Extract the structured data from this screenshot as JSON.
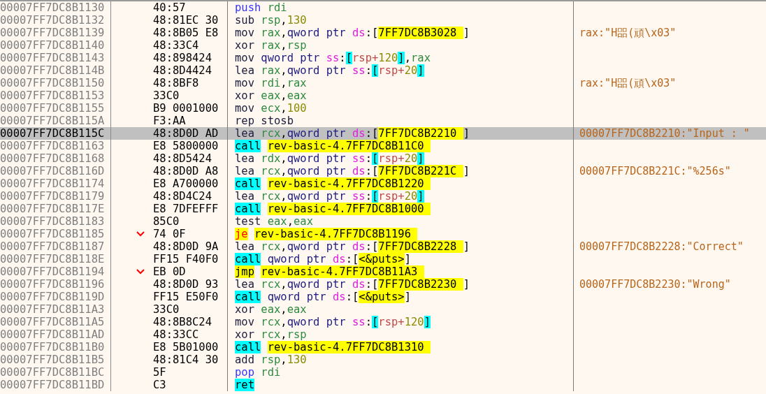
{
  "rows": [
    {
      "address": "00007FF7DC8B1130",
      "bytes": "40:57",
      "branch": false,
      "selected": false,
      "instruction": [
        {
          "text": "push ",
          "kind": "stack"
        },
        {
          "text": "rdi",
          "kind": "register"
        }
      ]
    },
    {
      "address": "00007FF7DC8B1132",
      "bytes": "48:81EC 30",
      "branch": false,
      "selected": false,
      "instruction": [
        {
          "text": "sub ",
          "kind": "mnemonic"
        },
        {
          "text": "rsp",
          "kind": "register"
        },
        {
          "text": ",",
          "kind": "punct"
        },
        {
          "text": "130",
          "kind": "number"
        }
      ]
    },
    {
      "address": "00007FF7DC8B1139",
      "bytes": "48:8B05 E8",
      "branch": false,
      "selected": false,
      "instruction": [
        {
          "text": "mov ",
          "kind": "mnemonic"
        },
        {
          "text": "rax",
          "kind": "register"
        },
        {
          "text": ",",
          "kind": "punct"
        },
        {
          "text": "qword ptr ",
          "kind": "size"
        },
        {
          "text": "ds",
          "kind": "segment"
        },
        {
          "text": ":[",
          "kind": "punct"
        },
        {
          "text": "7FF7DC8B3028 ",
          "kind": "address"
        },
        {
          "text": "]",
          "kind": "punct"
        }
      ],
      "comment": "rax:\"H㗊(頑\\x03\""
    },
    {
      "address": "00007FF7DC8B1140",
      "bytes": "48:33C4",
      "branch": false,
      "selected": false,
      "instruction": [
        {
          "text": "xor ",
          "kind": "mnemonic"
        },
        {
          "text": "rax",
          "kind": "register"
        },
        {
          "text": ",",
          "kind": "punct"
        },
        {
          "text": "rsp",
          "kind": "register"
        }
      ]
    },
    {
      "address": "00007FF7DC8B1143",
      "bytes": "48:898424",
      "branch": false,
      "selected": false,
      "instruction": [
        {
          "text": "mov ",
          "kind": "mnemonic"
        },
        {
          "text": "qword ptr ",
          "kind": "size"
        },
        {
          "text": "ss",
          "kind": "segment"
        },
        {
          "text": ":",
          "kind": "punct"
        },
        {
          "text": "[",
          "kind": "bracket"
        },
        {
          "text": "rsp+",
          "kind": "base"
        },
        {
          "text": "120",
          "kind": "number"
        },
        {
          "text": "]",
          "kind": "bracket"
        },
        {
          "text": ",",
          "kind": "punct"
        },
        {
          "text": "rax",
          "kind": "register"
        }
      ]
    },
    {
      "address": "00007FF7DC8B114B",
      "bytes": "48:8D4424",
      "branch": false,
      "selected": false,
      "instruction": [
        {
          "text": "lea ",
          "kind": "mnemonic"
        },
        {
          "text": "rax",
          "kind": "register"
        },
        {
          "text": ",",
          "kind": "punct"
        },
        {
          "text": "qword ptr ",
          "kind": "size"
        },
        {
          "text": "ss",
          "kind": "segment"
        },
        {
          "text": ":",
          "kind": "punct"
        },
        {
          "text": "[",
          "kind": "bracket"
        },
        {
          "text": "rsp+",
          "kind": "base"
        },
        {
          "text": "20",
          "kind": "number"
        },
        {
          "text": "]",
          "kind": "bracket"
        }
      ]
    },
    {
      "address": "00007FF7DC8B1150",
      "bytes": "48:8BF8",
      "branch": false,
      "selected": false,
      "instruction": [
        {
          "text": "mov ",
          "kind": "mnemonic"
        },
        {
          "text": "rdi",
          "kind": "register"
        },
        {
          "text": ",",
          "kind": "punct"
        },
        {
          "text": "rax",
          "kind": "register"
        }
      ],
      "comment": "rax:\"H㗊(頑\\x03\""
    },
    {
      "address": "00007FF7DC8B1153",
      "bytes": "33C0",
      "branch": false,
      "selected": false,
      "instruction": [
        {
          "text": "xor ",
          "kind": "mnemonic"
        },
        {
          "text": "eax",
          "kind": "register"
        },
        {
          "text": ",",
          "kind": "punct"
        },
        {
          "text": "eax",
          "kind": "register"
        }
      ]
    },
    {
      "address": "00007FF7DC8B1155",
      "bytes": "B9 0001000",
      "branch": false,
      "selected": false,
      "instruction": [
        {
          "text": "mov ",
          "kind": "mnemonic"
        },
        {
          "text": "ecx",
          "kind": "register"
        },
        {
          "text": ",",
          "kind": "punct"
        },
        {
          "text": "100",
          "kind": "number"
        }
      ]
    },
    {
      "address": "00007FF7DC8B115A",
      "bytes": "F3:AA",
      "branch": false,
      "selected": false,
      "instruction": [
        {
          "text": "rep stosb",
          "kind": "mnemonic"
        }
      ]
    },
    {
      "address": "00007FF7DC8B115C",
      "bytes": "48:8D0D AD",
      "branch": false,
      "selected": true,
      "instruction": [
        {
          "text": "lea ",
          "kind": "mnemonic"
        },
        {
          "text": "rcx",
          "kind": "register"
        },
        {
          "text": ",",
          "kind": "punct"
        },
        {
          "text": "qword ptr ",
          "kind": "size"
        },
        {
          "text": "ds",
          "kind": "segment"
        },
        {
          "text": ":[",
          "kind": "punct"
        },
        {
          "text": "7FF7DC8B2210 ",
          "kind": "address"
        },
        {
          "text": "]",
          "kind": "punct"
        }
      ],
      "comment": "00007FF7DC8B2210:\"Input : \""
    },
    {
      "address": "00007FF7DC8B1163",
      "bytes": "E8 5800000",
      "branch": false,
      "selected": false,
      "instruction": [
        {
          "text": "call",
          "kind": "call"
        },
        {
          "text": " rev-basic-4.7FF7DC8B11C0 ",
          "kind": "address"
        }
      ]
    },
    {
      "address": "00007FF7DC8B1168",
      "bytes": "48:8D5424",
      "branch": false,
      "selected": false,
      "instruction": [
        {
          "text": "lea ",
          "kind": "mnemonic"
        },
        {
          "text": "rdx",
          "kind": "register"
        },
        {
          "text": ",",
          "kind": "punct"
        },
        {
          "text": "qword ptr ",
          "kind": "size"
        },
        {
          "text": "ss",
          "kind": "segment"
        },
        {
          "text": ":",
          "kind": "punct"
        },
        {
          "text": "[",
          "kind": "bracket"
        },
        {
          "text": "rsp+",
          "kind": "base"
        },
        {
          "text": "20",
          "kind": "number"
        },
        {
          "text": "]",
          "kind": "bracket"
        }
      ]
    },
    {
      "address": "00007FF7DC8B116D",
      "bytes": "48:8D0D A8",
      "branch": false,
      "selected": false,
      "instruction": [
        {
          "text": "lea ",
          "kind": "mnemonic"
        },
        {
          "text": "rcx",
          "kind": "register"
        },
        {
          "text": ",",
          "kind": "punct"
        },
        {
          "text": "qword ptr ",
          "kind": "size"
        },
        {
          "text": "ds",
          "kind": "segment"
        },
        {
          "text": ":[",
          "kind": "punct"
        },
        {
          "text": "7FF7DC8B221C ",
          "kind": "address"
        },
        {
          "text": "]",
          "kind": "punct"
        }
      ],
      "comment": "00007FF7DC8B221C:\"%256s\""
    },
    {
      "address": "00007FF7DC8B1174",
      "bytes": "E8 A700000",
      "branch": false,
      "selected": false,
      "instruction": [
        {
          "text": "call",
          "kind": "call"
        },
        {
          "text": " rev-basic-4.7FF7DC8B1220 ",
          "kind": "address"
        }
      ]
    },
    {
      "address": "00007FF7DC8B1179",
      "bytes": "48:8D4C24",
      "branch": false,
      "selected": false,
      "instruction": [
        {
          "text": "lea ",
          "kind": "mnemonic"
        },
        {
          "text": "rcx",
          "kind": "register"
        },
        {
          "text": ",",
          "kind": "punct"
        },
        {
          "text": "qword ptr ",
          "kind": "size"
        },
        {
          "text": "ss",
          "kind": "segment"
        },
        {
          "text": ":",
          "kind": "punct"
        },
        {
          "text": "[",
          "kind": "bracket"
        },
        {
          "text": "rsp+",
          "kind": "base"
        },
        {
          "text": "20",
          "kind": "number"
        },
        {
          "text": "]",
          "kind": "bracket"
        }
      ]
    },
    {
      "address": "00007FF7DC8B117E",
      "bytes": "E8 7DFEFFF",
      "branch": false,
      "selected": false,
      "instruction": [
        {
          "text": "call",
          "kind": "call"
        },
        {
          "text": " rev-basic-4.7FF7DC8B1000 ",
          "kind": "address"
        }
      ]
    },
    {
      "address": "00007FF7DC8B1183",
      "bytes": "85C0",
      "branch": false,
      "selected": false,
      "instruction": [
        {
          "text": "test ",
          "kind": "mnemonic"
        },
        {
          "text": "eax",
          "kind": "register"
        },
        {
          "text": ",",
          "kind": "punct"
        },
        {
          "text": "eax",
          "kind": "register"
        }
      ]
    },
    {
      "address": "00007FF7DC8B1185",
      "bytes": "74 0F",
      "branch": true,
      "selected": false,
      "instruction": [
        {
          "text": "je",
          "kind": "condjump"
        },
        {
          "text": " rev-basic-4.7FF7DC8B1196 ",
          "kind": "address"
        }
      ]
    },
    {
      "address": "00007FF7DC8B1187",
      "bytes": "48:8D0D 9A",
      "branch": false,
      "selected": false,
      "instruction": [
        {
          "text": "lea ",
          "kind": "mnemonic"
        },
        {
          "text": "rcx",
          "kind": "register"
        },
        {
          "text": ",",
          "kind": "punct"
        },
        {
          "text": "qword ptr ",
          "kind": "size"
        },
        {
          "text": "ds",
          "kind": "segment"
        },
        {
          "text": ":[",
          "kind": "punct"
        },
        {
          "text": "7FF7DC8B2228 ",
          "kind": "address"
        },
        {
          "text": "]",
          "kind": "punct"
        }
      ],
      "comment": "00007FF7DC8B2228:\"Correct\""
    },
    {
      "address": "00007FF7DC8B118E",
      "bytes": "FF15 F40F0",
      "branch": false,
      "selected": false,
      "instruction": [
        {
          "text": "call",
          "kind": "call"
        },
        {
          "text": " qword ptr ",
          "kind": "size"
        },
        {
          "text": "ds",
          "kind": "segment"
        },
        {
          "text": ":[",
          "kind": "punct"
        },
        {
          "text": "<&puts>",
          "kind": "address"
        },
        {
          "text": "]",
          "kind": "punct"
        }
      ]
    },
    {
      "address": "00007FF7DC8B1194",
      "bytes": "EB 0D",
      "branch": true,
      "selected": false,
      "instruction": [
        {
          "text": "jmp",
          "kind": "jump"
        },
        {
          "text": " rev-basic-4.7FF7DC8B11A3 ",
          "kind": "address"
        }
      ]
    },
    {
      "address": "00007FF7DC8B1196",
      "bytes": "48:8D0D 93",
      "branch": false,
      "selected": false,
      "instruction": [
        {
          "text": "lea ",
          "kind": "mnemonic"
        },
        {
          "text": "rcx",
          "kind": "register"
        },
        {
          "text": ",",
          "kind": "punct"
        },
        {
          "text": "qword ptr ",
          "kind": "size"
        },
        {
          "text": "ds",
          "kind": "segment"
        },
        {
          "text": ":[",
          "kind": "punct"
        },
        {
          "text": "7FF7DC8B2230 ",
          "kind": "address"
        },
        {
          "text": "]",
          "kind": "punct"
        }
      ],
      "comment": "00007FF7DC8B2230:\"Wrong\""
    },
    {
      "address": "00007FF7DC8B119D",
      "bytes": "FF15 E50F0",
      "branch": false,
      "selected": false,
      "instruction": [
        {
          "text": "call",
          "kind": "call"
        },
        {
          "text": " qword ptr ",
          "kind": "size"
        },
        {
          "text": "ds",
          "kind": "segment"
        },
        {
          "text": ":[",
          "kind": "punct"
        },
        {
          "text": "<&puts>",
          "kind": "address"
        },
        {
          "text": "]",
          "kind": "punct"
        }
      ]
    },
    {
      "address": "00007FF7DC8B11A3",
      "bytes": "33C0",
      "branch": false,
      "selected": false,
      "instruction": [
        {
          "text": "xor ",
          "kind": "mnemonic"
        },
        {
          "text": "eax",
          "kind": "register"
        },
        {
          "text": ",",
          "kind": "punct"
        },
        {
          "text": "eax",
          "kind": "register"
        }
      ]
    },
    {
      "address": "00007FF7DC8B11A5",
      "bytes": "48:8B8C24",
      "branch": false,
      "selected": false,
      "instruction": [
        {
          "text": "mov ",
          "kind": "mnemonic"
        },
        {
          "text": "rcx",
          "kind": "register"
        },
        {
          "text": ",",
          "kind": "punct"
        },
        {
          "text": "qword ptr ",
          "kind": "size"
        },
        {
          "text": "ss",
          "kind": "segment"
        },
        {
          "text": ":",
          "kind": "punct"
        },
        {
          "text": "[",
          "kind": "bracket"
        },
        {
          "text": "rsp+",
          "kind": "base"
        },
        {
          "text": "120",
          "kind": "number"
        },
        {
          "text": "]",
          "kind": "bracket"
        }
      ]
    },
    {
      "address": "00007FF7DC8B11AD",
      "bytes": "48:33CC",
      "branch": false,
      "selected": false,
      "instruction": [
        {
          "text": "xor ",
          "kind": "mnemonic"
        },
        {
          "text": "rcx",
          "kind": "register"
        },
        {
          "text": ",",
          "kind": "punct"
        },
        {
          "text": "rsp",
          "kind": "register"
        }
      ]
    },
    {
      "address": "00007FF7DC8B11B0",
      "bytes": "E8 5B01000",
      "branch": false,
      "selected": false,
      "instruction": [
        {
          "text": "call",
          "kind": "call"
        },
        {
          "text": " rev-basic-4.7FF7DC8B1310 ",
          "kind": "address"
        }
      ]
    },
    {
      "address": "00007FF7DC8B11B5",
      "bytes": "48:81C4 30",
      "branch": false,
      "selected": false,
      "instruction": [
        {
          "text": "add ",
          "kind": "mnemonic"
        },
        {
          "text": "rsp",
          "kind": "register"
        },
        {
          "text": ",",
          "kind": "punct"
        },
        {
          "text": "130",
          "kind": "number"
        }
      ]
    },
    {
      "address": "00007FF7DC8B11BC",
      "bytes": "5F",
      "branch": false,
      "selected": false,
      "instruction": [
        {
          "text": "pop ",
          "kind": "stack"
        },
        {
          "text": "rdi",
          "kind": "register"
        }
      ]
    },
    {
      "address": "00007FF7DC8B11BD",
      "bytes": "C3",
      "branch": false,
      "selected": false,
      "instruction": [
        {
          "text": "ret",
          "kind": "call"
        }
      ]
    }
  ]
}
